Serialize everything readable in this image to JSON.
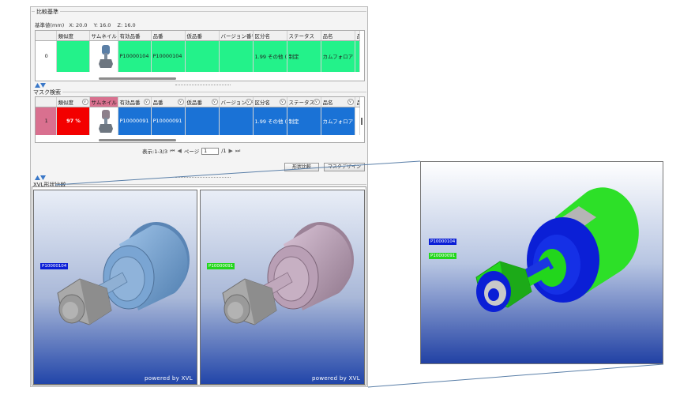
{
  "compare_base": {
    "title": "比較基準",
    "coords_label": "基準値(mm)",
    "x": "X: 20.0",
    "y": "Y: 16.0",
    "z": "Z: 16.0"
  },
  "columns": [
    "類似度",
    "サムネイル",
    "有効品番",
    "品番",
    "仮品番",
    "バージョン番号",
    "区分名",
    "ステータス",
    "品名",
    "品"
  ],
  "base_row": {
    "index": "0",
    "similarity": "",
    "valid_number": "P10000104",
    "part_number": "P10000104",
    "temp_number": "",
    "version": "",
    "category": "1.99 その他 (...",
    "status": "制定",
    "name": "カムフォロア"
  },
  "mask_search": {
    "title": "マスク検索"
  },
  "result_row": {
    "index": "1",
    "similarity": "97 %",
    "valid_number": "P10000091",
    "part_number": "P10000091",
    "temp_number": "",
    "version": "",
    "category": "1.99 その他 (...",
    "status": "制定",
    "name": "カムフォロア"
  },
  "pager": {
    "range": "表示:1-3/3",
    "page_label": "ページ",
    "page_value": "1",
    "total": "/1"
  },
  "buttons": {
    "shape_compare": "形状比較",
    "mask_tab": "マスクデザイン"
  },
  "xvl": {
    "title": "XVL形状比較",
    "left_label": "P10000104",
    "right_label": "P10000091",
    "powered": "powered by XVL"
  },
  "zoom": {
    "label_a": "P10000104",
    "label_b": "P10000091"
  },
  "colors": {
    "base_row": "#23f28a",
    "result_row": "#1a72d6",
    "similarity_bg": "#f30000",
    "label_a_bg": "#0b1fd6",
    "label_b_bg": "#22d61c",
    "viewer_top": "#e9eef7",
    "viewer_bottom": "#1f43a8",
    "part_a": "#6f9ed0",
    "part_b": "#b89bb6",
    "nut": "#a9a9a9"
  }
}
